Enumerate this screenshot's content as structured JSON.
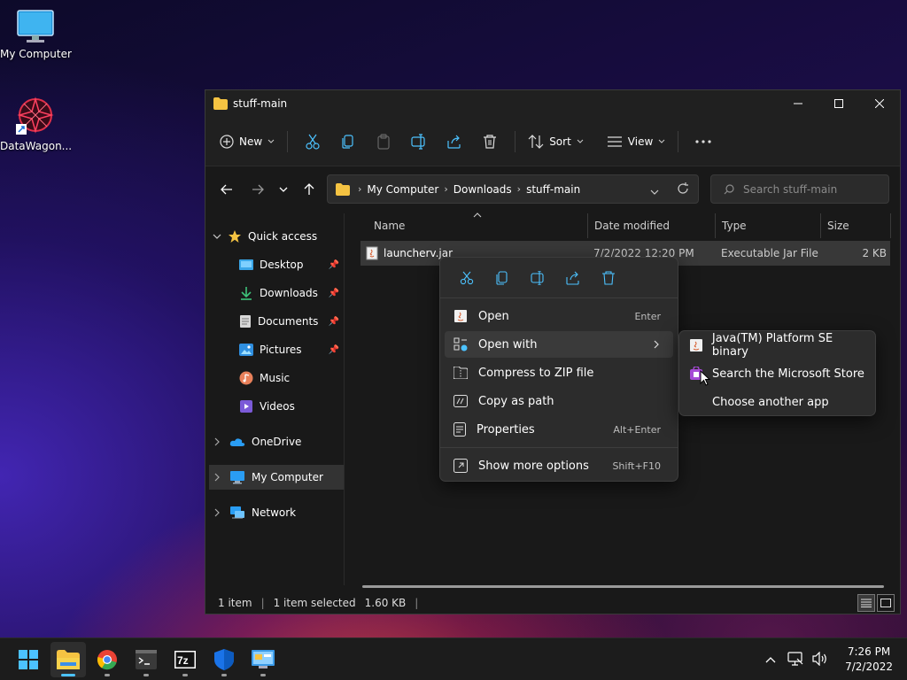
{
  "desktop": {
    "icons": [
      {
        "label": "My Computer",
        "icon": "monitor-icon"
      },
      {
        "label": "DataWagon...",
        "icon": "datawagon-app-icon"
      }
    ]
  },
  "window": {
    "title": "stuff-main",
    "controls": {
      "minimize": "minimize-icon",
      "maximize": "maximize-icon",
      "close": "close-icon"
    }
  },
  "toolbar": {
    "new_label": "New",
    "sort_label": "Sort",
    "view_label": "View"
  },
  "address": {
    "crumbs": [
      "My Computer",
      "Downloads",
      "stuff-main"
    ],
    "search_placeholder": "Search stuff-main"
  },
  "sidebar": {
    "quick_access": "Quick access",
    "items": [
      {
        "label": "Desktop",
        "pinned": true
      },
      {
        "label": "Downloads",
        "pinned": true
      },
      {
        "label": "Documents",
        "pinned": true
      },
      {
        "label": "Pictures",
        "pinned": true
      },
      {
        "label": "Music",
        "pinned": false
      },
      {
        "label": "Videos",
        "pinned": false
      }
    ],
    "onedrive": "OneDrive",
    "my_computer": "My Computer",
    "network": "Network"
  },
  "columns": {
    "name": "Name",
    "date": "Date modified",
    "type": "Type",
    "size": "Size"
  },
  "files": [
    {
      "name": "launcherv.jar",
      "date": "7/2/2022 12:20 PM",
      "type": "Executable Jar File",
      "size": "2 KB"
    }
  ],
  "context_menu": {
    "items": [
      {
        "label": "Open",
        "shortcut": "Enter"
      },
      {
        "label": "Open with",
        "shortcut": ""
      },
      {
        "label": "Compress to ZIP file",
        "shortcut": ""
      },
      {
        "label": "Copy as path",
        "shortcut": ""
      },
      {
        "label": "Properties",
        "shortcut": "Alt+Enter"
      },
      {
        "label": "Show more options",
        "shortcut": "Shift+F10"
      }
    ]
  },
  "submenu": {
    "items": [
      {
        "label": "Java(TM) Platform SE binary"
      },
      {
        "label": "Search the Microsoft Store"
      },
      {
        "label": "Choose another app"
      }
    ]
  },
  "status": {
    "count": "1 item",
    "selected": "1 item selected",
    "size": "1.60 KB"
  },
  "taskbar": {
    "time": "7:26 PM",
    "date": "7/2/2022",
    "apps": [
      "start-icon",
      "file-explorer-icon",
      "chrome-icon",
      "terminal-icon",
      "7zip-icon",
      "defender-icon",
      "control-panel-icon"
    ]
  },
  "colors": {
    "accent": "#4cc2ff",
    "folder": "#f5c342",
    "selection": "#383838"
  }
}
